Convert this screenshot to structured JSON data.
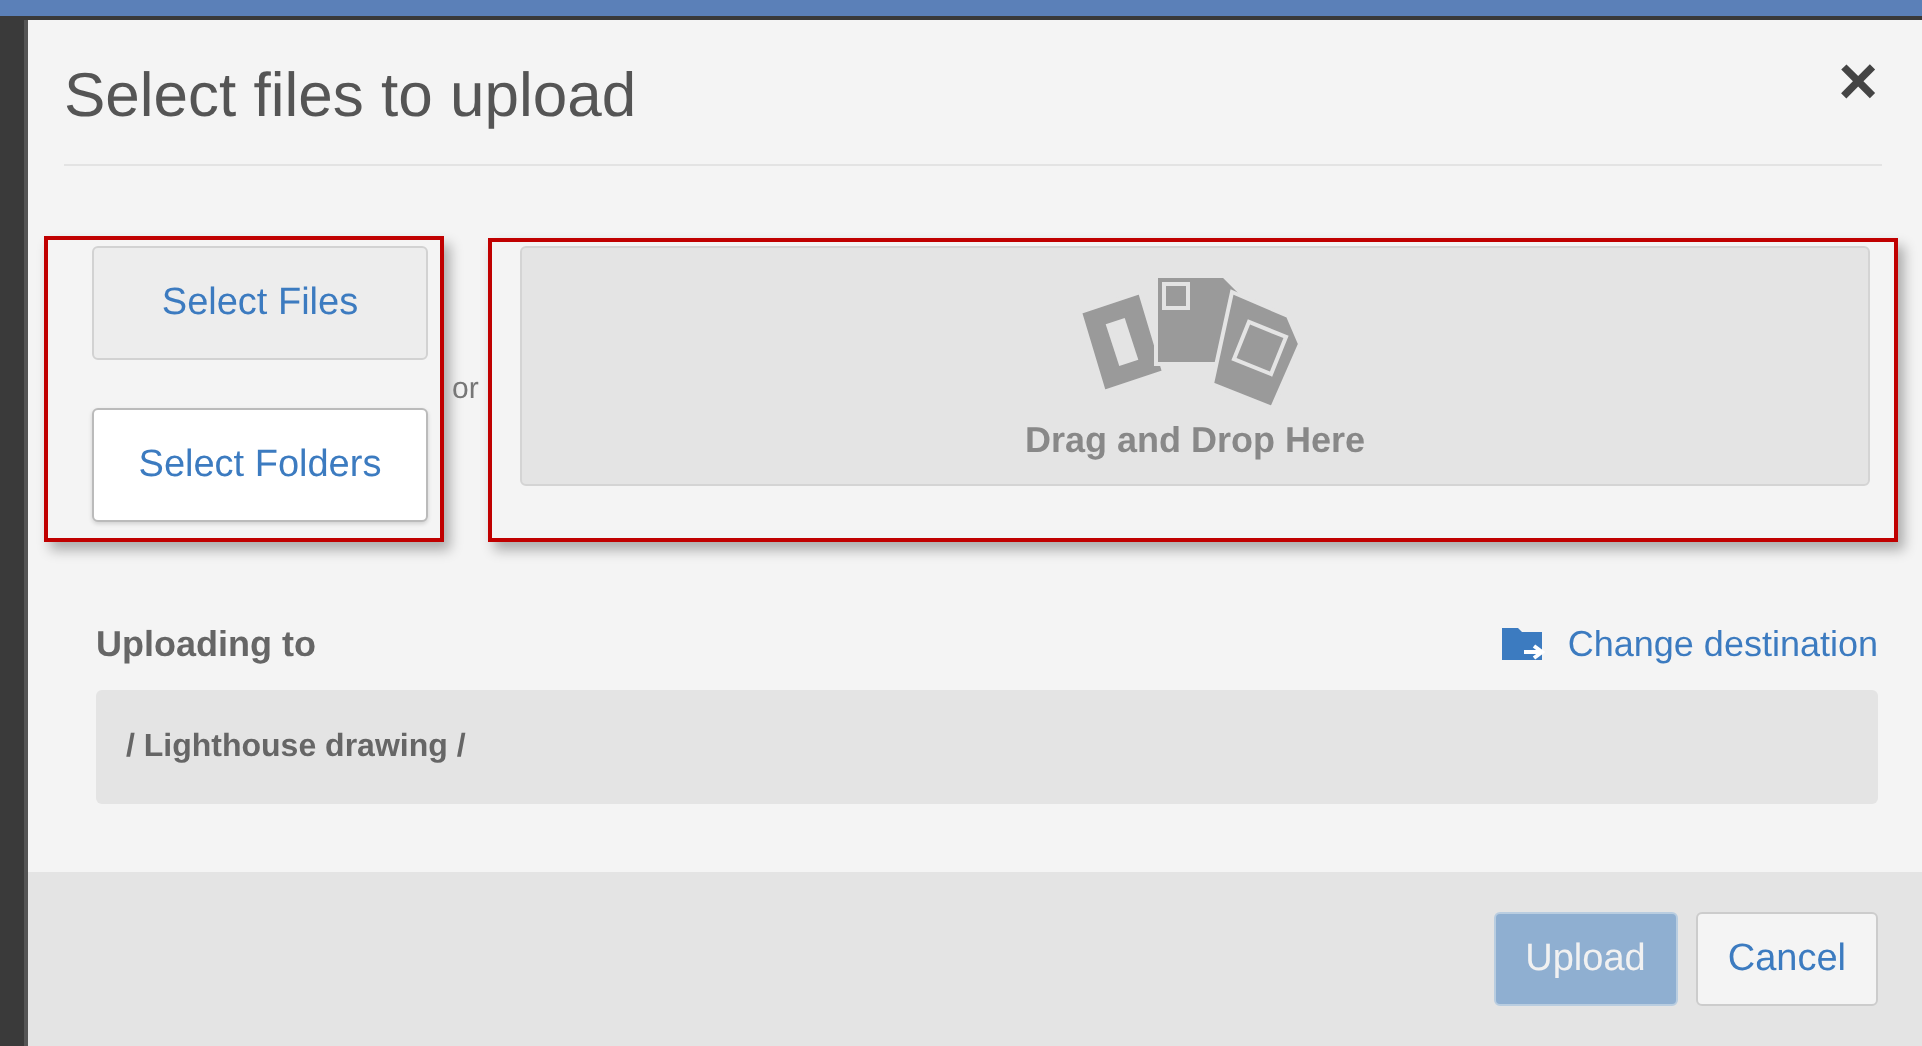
{
  "dialog": {
    "title": "Select files to upload",
    "close": "×"
  },
  "pickers": [
    {
      "label": "Select Files",
      "hovered": false
    },
    {
      "label": "Select Folders",
      "hovered": true
    }
  ],
  "separator": "or",
  "drop_zone": {
    "label": "Drag and Drop Here"
  },
  "destination": {
    "label": "Uploading to",
    "change_link": "Change destination",
    "path": "/ Lighthouse drawing /"
  },
  "footer_buttons": [
    {
      "label": "Upload",
      "kind": "primary",
      "disabled": true
    },
    {
      "label": "Cancel",
      "kind": "default",
      "disabled": false
    }
  ]
}
